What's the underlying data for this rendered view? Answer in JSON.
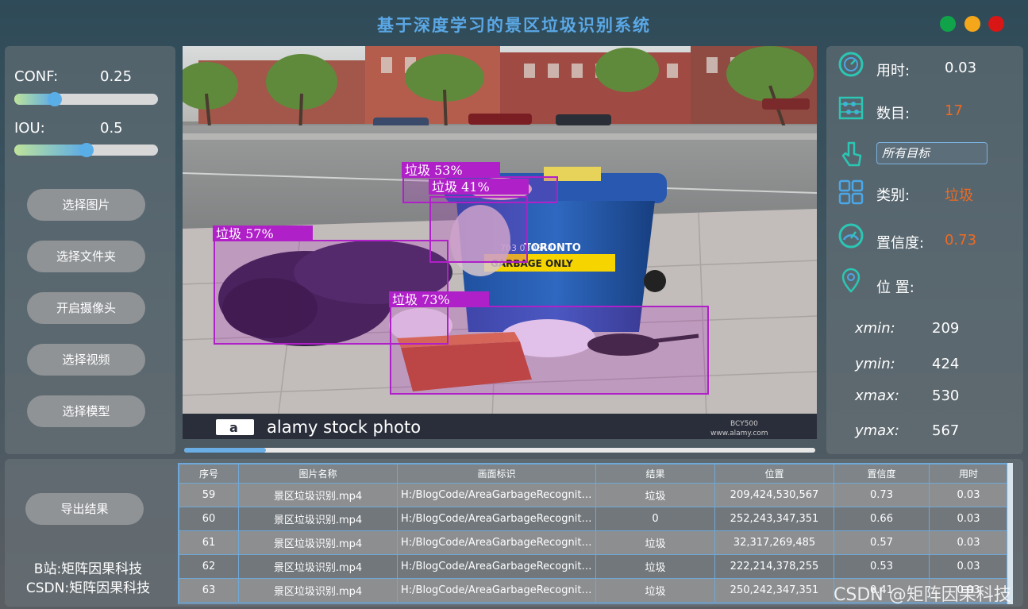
{
  "app": {
    "title": "基于深度学习的景区垃圾识别系统"
  },
  "params": {
    "conf_label": "CONF:",
    "conf_value": "0.25",
    "conf_fraction": 0.28,
    "iou_label": "IOU:",
    "iou_value": "0.5",
    "iou_fraction": 0.5
  },
  "buttons": {
    "select_image": "选择图片",
    "select_folder": "选择文件夹",
    "open_camera": "开启摄像头",
    "select_video": "选择视频",
    "select_model": "选择模型",
    "export": "导出结果"
  },
  "detections": [
    {
      "label": "垃圾 53%"
    },
    {
      "label": "垃圾 41%"
    },
    {
      "label": "垃圾 57%"
    },
    {
      "label": "垃圾 73%"
    }
  ],
  "scene": {
    "bin_text": "TORONTO",
    "bin_sign": "GARBAGE ONLY",
    "bin_number": "703   030544",
    "stock_brand": "alamy stock photo",
    "stock_logo": "a",
    "stock_id": "BCY500",
    "stock_url": "www.alamy.com"
  },
  "progress_fraction": 0.13,
  "info": {
    "time_label": "用时:",
    "time_value": "0.03",
    "count_label": "数目:",
    "count_value": "17",
    "target_value": "所有目标",
    "class_label": "类别:",
    "class_value": "垃圾",
    "conf_label": "置信度:",
    "conf_value": "0.73",
    "pos_label": "位 置:",
    "xmin_label": "xmin:",
    "xmin_value": "209",
    "ymin_label": "ymin:",
    "ymin_value": "424",
    "xmax_label": "xmax:",
    "xmax_value": "530",
    "ymax_label": "ymax:",
    "ymax_value": "567"
  },
  "table": {
    "headers": [
      "序号",
      "图片名称",
      "画面标识",
      "结果",
      "位置",
      "置信度",
      "用时"
    ],
    "rows": [
      [
        "59",
        "景区垃圾识别.mp4",
        "H:/BlogCode/AreaGarbageRecognitio...",
        "垃圾",
        "209,424,530,567",
        "0.73",
        "0.03"
      ],
      [
        "60",
        "景区垃圾识别.mp4",
        "H:/BlogCode/AreaGarbageRecognitio...",
        "0",
        "252,243,347,351",
        "0.66",
        "0.03"
      ],
      [
        "61",
        "景区垃圾识别.mp4",
        "H:/BlogCode/AreaGarbageRecognitio...",
        "垃圾",
        "32,317,269,485",
        "0.57",
        "0.03"
      ],
      [
        "62",
        "景区垃圾识别.mp4",
        "H:/BlogCode/AreaGarbageRecognitio...",
        "垃圾",
        "222,214,378,255",
        "0.53",
        "0.03"
      ],
      [
        "63",
        "景区垃圾识别.mp4",
        "H:/BlogCode/AreaGarbageRecognitio...",
        "垃圾",
        "250,242,347,351",
        "0.41",
        "0.03"
      ]
    ]
  },
  "credits": {
    "bilibili": "B站:矩阵因果科技",
    "csdn": "CSDN:矩阵因果科技"
  },
  "watermark": "CSDN @矩阵因果科技",
  "colors": {
    "accent": "#5aa8e6",
    "highlight": "#ee6a22",
    "box": "#b020c8"
  }
}
